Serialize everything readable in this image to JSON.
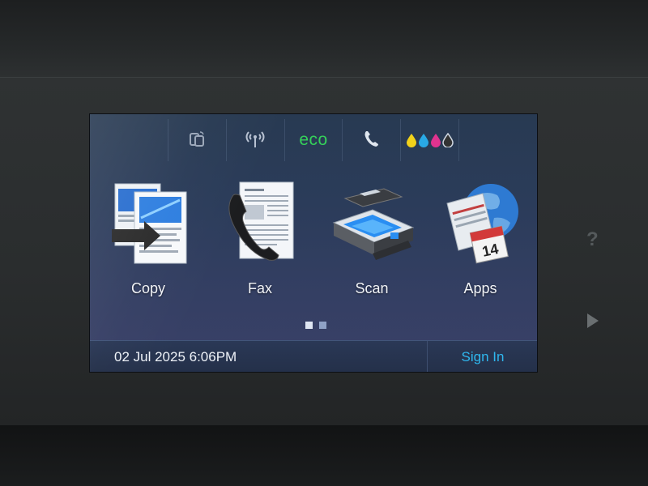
{
  "status_bar": {
    "items": [
      {
        "icon": "wireless-direct-icon"
      },
      {
        "icon": "wireless-icon"
      },
      {
        "icon": "eco-icon",
        "label": "eco"
      },
      {
        "icon": "fax-status-icon"
      },
      {
        "icon": "ink-levels-icon"
      }
    ]
  },
  "apps": [
    {
      "label": "Copy",
      "icon": "copy-icon"
    },
    {
      "label": "Fax",
      "icon": "fax-icon"
    },
    {
      "label": "Scan",
      "icon": "scan-icon"
    },
    {
      "label": "Apps",
      "icon": "apps-icon",
      "calendar_day": "14"
    }
  ],
  "pagination": {
    "current": 1,
    "total": 2
  },
  "footer": {
    "datetime": "02 Jul 2025 6:06PM",
    "sign_in_label": "Sign In"
  },
  "colors": {
    "accent": "#2fb7ee",
    "eco": "#35d05a",
    "ink": [
      "#f2d21a",
      "#29a9e6",
      "#e0338f",
      "#333333"
    ]
  }
}
